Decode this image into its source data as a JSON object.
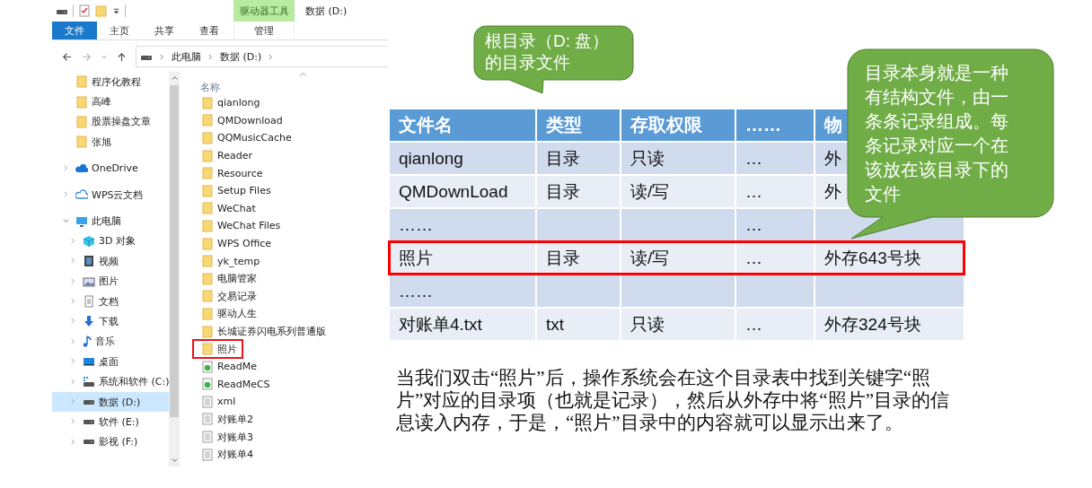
{
  "explorer": {
    "context_tab": "驱动器工具",
    "title": "数据 (D:)",
    "ribbon_tabs": [
      {
        "label": "文件",
        "selected": true
      },
      {
        "label": "主页",
        "selected": false
      },
      {
        "label": "共享",
        "selected": false
      },
      {
        "label": "查看",
        "selected": false
      },
      {
        "label": "管理",
        "selected": false
      }
    ],
    "breadcrumb": [
      "此电脑",
      "数据 (D:)"
    ],
    "nav": [
      {
        "label": "程序化教程",
        "kind": "folder",
        "selected": false
      },
      {
        "label": "高峰",
        "kind": "folder",
        "selected": false
      },
      {
        "label": "股票操盘文章",
        "kind": "folder",
        "selected": false
      },
      {
        "label": "张旭",
        "kind": "folder",
        "selected": false
      },
      {
        "label": "OneDrive",
        "kind": "onedrive",
        "expanded": false,
        "selected": false
      },
      {
        "label": "WPS云文档",
        "kind": "cloud",
        "expanded": false,
        "selected": false
      },
      {
        "label": "此电脑",
        "kind": "computer",
        "expanded": true,
        "selected": false,
        "children": [
          {
            "label": "3D 对象",
            "kind": "cube",
            "expanded": false,
            "selected": false
          },
          {
            "label": "视频",
            "kind": "film",
            "expanded": false,
            "selected": false
          },
          {
            "label": "图片",
            "kind": "image",
            "expanded": false,
            "selected": false
          },
          {
            "label": "文档",
            "kind": "doc",
            "expanded": false,
            "selected": false
          },
          {
            "label": "下载",
            "kind": "download",
            "expanded": false,
            "selected": false
          },
          {
            "label": "音乐",
            "kind": "music",
            "expanded": false,
            "selected": false
          },
          {
            "label": "桌面",
            "kind": "desktop",
            "expanded": false,
            "selected": false
          },
          {
            "label": "系统和软件 (C:)",
            "kind": "windrive",
            "expanded": false,
            "selected": false
          },
          {
            "label": "数据 (D:)",
            "kind": "drive",
            "expanded": false,
            "selected": true
          },
          {
            "label": "软件 (E:)",
            "kind": "drive",
            "expanded": false,
            "selected": false
          },
          {
            "label": "影视 (F:)",
            "kind": "drive",
            "expanded": false,
            "selected": false
          }
        ]
      }
    ],
    "list_header": "名称",
    "files": [
      {
        "name": "qianlong",
        "kind": "folder",
        "highlighted": false
      },
      {
        "name": "QMDownload",
        "kind": "folder",
        "highlighted": false
      },
      {
        "name": "QQMusicCache",
        "kind": "folder",
        "highlighted": false
      },
      {
        "name": "Reader",
        "kind": "folder",
        "highlighted": false
      },
      {
        "name": "Resource",
        "kind": "folder",
        "highlighted": false
      },
      {
        "name": "Setup Files",
        "kind": "folder",
        "highlighted": false
      },
      {
        "name": "WeChat",
        "kind": "folder",
        "highlighted": false
      },
      {
        "name": "WeChat Files",
        "kind": "folder",
        "highlighted": false
      },
      {
        "name": "WPS Office",
        "kind": "folder",
        "highlighted": false
      },
      {
        "name": "yk_temp",
        "kind": "folder",
        "highlighted": false
      },
      {
        "name": "电脑管家",
        "kind": "folder",
        "highlighted": false
      },
      {
        "name": "交易记录",
        "kind": "folder",
        "highlighted": false
      },
      {
        "name": "驱动人生",
        "kind": "folder",
        "highlighted": false
      },
      {
        "name": "长城证券闪电系列普通版",
        "kind": "folder",
        "highlighted": false
      },
      {
        "name": "照片",
        "kind": "folder",
        "highlighted": true
      },
      {
        "name": "ReadMe",
        "kind": "web",
        "highlighted": false
      },
      {
        "name": "ReadMeCS",
        "kind": "web",
        "highlighted": false
      },
      {
        "name": "xml",
        "kind": "doc",
        "highlighted": false
      },
      {
        "name": "对账单2",
        "kind": "doc",
        "highlighted": false
      },
      {
        "name": "对账单3",
        "kind": "doc",
        "highlighted": false
      },
      {
        "name": "对账单4",
        "kind": "doc",
        "highlighted": false
      }
    ]
  },
  "callouts": [
    {
      "text": "根目录（D: 盘）的目录文件"
    },
    {
      "text": "目录本身就是一种有结构文件，由一条条记录组成。每条记录对应一个在该放在该目录下的文件"
    }
  ],
  "table": {
    "columns": [
      "文件名",
      "类型",
      "存取权限",
      "……",
      "物"
    ],
    "rows": [
      {
        "file_name": "qianlong",
        "type": "目录",
        "access": "只读",
        "column_4": "…",
        "location": "外",
        "highlighted": false
      },
      {
        "file_name": "QMDownLoad",
        "type": "目录",
        "access": "读/写",
        "column_4": "…",
        "location": "外",
        "highlighted": false
      },
      {
        "file_name": "……",
        "column_4": "…",
        "highlighted": false
      },
      {
        "file_name": "照片",
        "type": "目录",
        "access": "读/写",
        "column_4": "…",
        "location": "外存643号块",
        "highlighted": true
      },
      {
        "file_name": "……",
        "highlighted": false
      },
      {
        "file_name": "对账单4.txt",
        "type": "txt",
        "access": "只读",
        "column_4": "…",
        "location": "外存324号块",
        "highlighted": false
      }
    ]
  },
  "explanation": "当我们双击“照片”后，操作系统会在这个目录表中找到关键字“照片”对应的目录项（也就是记录），然后从外存中将“照片”目录的信息读入内存，于是，“照片”目录中的内容就可以显示出来了。"
}
